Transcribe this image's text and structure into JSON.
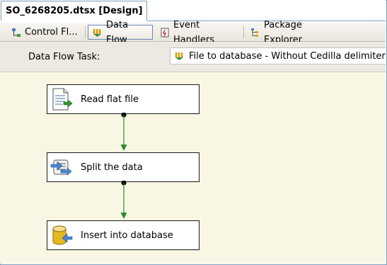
{
  "document_tab": {
    "title": "SO_6268205.dtsx [Design]"
  },
  "designer_tabs": [
    {
      "label": "Control Fl...",
      "icon": "control-flow-icon",
      "active": false
    },
    {
      "label": "Data Flow",
      "icon": "data-flow-icon",
      "active": true
    },
    {
      "label": "Event Handlers",
      "icon": "event-handlers-icon",
      "active": false
    },
    {
      "label": "Package Explorer",
      "icon": "package-explorer-icon",
      "active": false
    }
  ],
  "task_selector": {
    "label": "Data Flow Task:",
    "selected": "File to database - Without Cedilla delimiter",
    "icon": "data-flow-task-icon"
  },
  "components": [
    {
      "name": "Read flat file",
      "icon": "flat-file-source-icon"
    },
    {
      "name": "Split the data",
      "icon": "script-component-icon"
    },
    {
      "name": "Insert into database",
      "icon": "ole-db-destination-icon"
    }
  ],
  "colors": {
    "connector": "#2e8b2e",
    "canvas": "#faf6e4",
    "border": "#7f9db9"
  }
}
